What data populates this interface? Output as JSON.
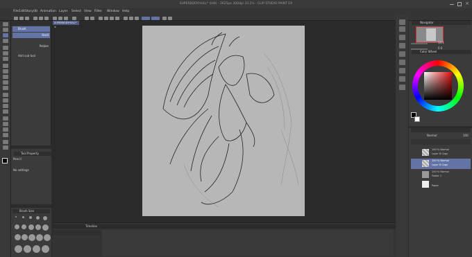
{
  "window": {
    "title": "SUPERBODYHULL* (Hi9) - 2625px 300dpi 33.1% - CLIP STUDIO PAINT EX"
  },
  "menu": {
    "items": [
      "File",
      "Edit",
      "Story(B)",
      "Animation",
      "Layer",
      "Select",
      "View",
      "Filter",
      "Window",
      "Help"
    ]
  },
  "doc": {
    "tab": "SUPERBODYHULL* ×"
  },
  "subtool": {
    "items": [
      {
        "label": "Brush"
      },
      {
        "label": "Hard"
      },
      {
        "label": "Pebble"
      }
    ],
    "add_label": "Add sub tool"
  },
  "toolprop": {
    "title": "Tool Property",
    "name": "Pencil",
    "no_settings": "No settings"
  },
  "brushsize": {
    "title": "Brush Size"
  },
  "navigator": {
    "title": "Navigator",
    "zoom": "33.1",
    "angle": "0.0"
  },
  "colorwheel": {
    "title": "Color Wheel"
  },
  "layers": {
    "blend_mode": "Normal",
    "opacity": "100",
    "items": [
      {
        "line1": "100 % Normal",
        "line2": "Layer 8 Copy"
      },
      {
        "line1": "100 % Normal",
        "line2": "Layer 6 Copy"
      },
      {
        "line1": "100 % Normal",
        "line2": "Folder 1"
      },
      {
        "line1": "",
        "line2": "Paper"
      }
    ]
  },
  "timeline": {
    "title": "Timeline"
  },
  "colors": {
    "accent": "#6373a6",
    "paper": "#b7b7b7"
  }
}
